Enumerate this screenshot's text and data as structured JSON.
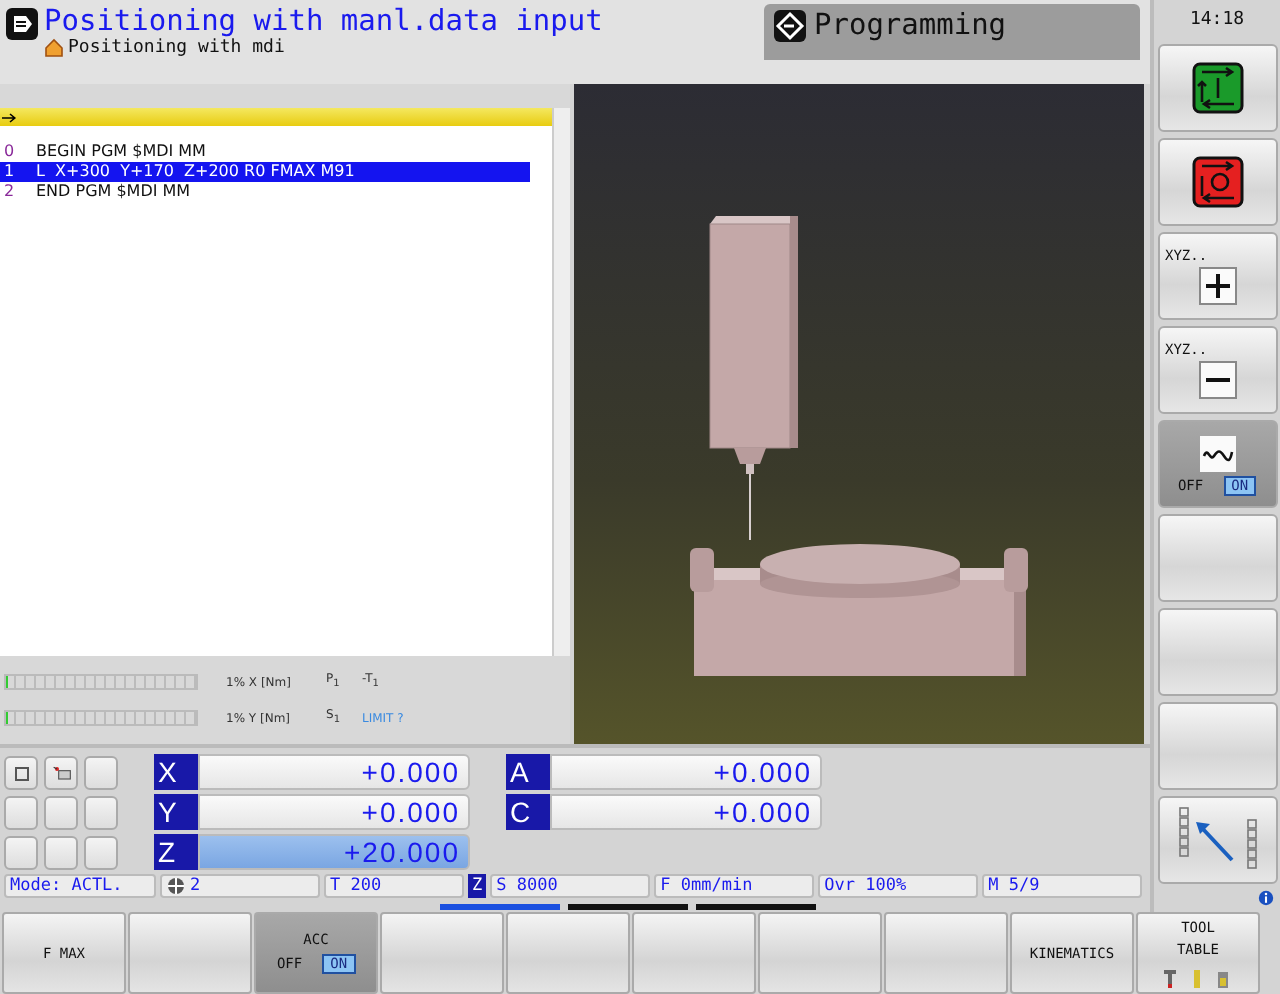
{
  "header": {
    "mode_title": "Positioning with manl.data input",
    "program_name": "Positioning with mdi",
    "secondary_mode": "Programming"
  },
  "clock": "14:18",
  "program": {
    "lines": [
      {
        "number": "0",
        "text": "BEGIN PGM $MDI MM",
        "selected": false
      },
      {
        "number": "1",
        "text": "L  X+300  Y+170  Z+200 R0 FMAX M91",
        "selected": true
      },
      {
        "number": "2",
        "text": "END PGM $MDI MM",
        "selected": false
      }
    ]
  },
  "load_meters": [
    {
      "level": 0.01,
      "reading": "1% X [Nm]",
      "param": "P$_{1}$",
      "value": "-T$_{1}$",
      "warning": false
    },
    {
      "level": 0.01,
      "reading": "1% Y [Nm]",
      "param": "S$_{1}$",
      "value": "LIMIT ?",
      "warning": true
    }
  ],
  "axes_left": [
    {
      "label": "X",
      "value": "+0.000",
      "selected": false
    },
    {
      "label": "Y",
      "value": "+0.000",
      "selected": false
    },
    {
      "label": "Z",
      "value": "+20.000",
      "selected": true
    }
  ],
  "axes_right": [
    {
      "label": "A",
      "value": "+0.000",
      "selected": false
    },
    {
      "label": "C",
      "value": "+0.000",
      "selected": false
    }
  ],
  "status_bar": {
    "mode": "Mode: ACTL.",
    "datum": "2",
    "tool": "T 200",
    "tool_axis": "Z",
    "spindle": "S 8000",
    "feed": "F 0mm/min",
    "override": "Ovr 100%",
    "m_functions": "M 5/9"
  },
  "side_softkeys": [
    {
      "kind": "start"
    },
    {
      "kind": "stop"
    },
    {
      "kind": "plus",
      "label": "XYZ.."
    },
    {
      "kind": "minus",
      "label": "XYZ.."
    },
    {
      "kind": "toggle",
      "off": "OFF",
      "on_label": "ON",
      "on": true
    },
    {
      "kind": "empty"
    },
    {
      "kind": "empty"
    },
    {
      "kind": "empty"
    },
    {
      "kind": "jog"
    }
  ],
  "softkey_pages": [
    {
      "selected": true
    },
    {
      "selected": false
    },
    {
      "selected": false
    }
  ],
  "softkeys": [
    {
      "kind": "text",
      "label": "F MAX"
    },
    {
      "kind": "empty"
    },
    {
      "kind": "toggle",
      "label": "ACC",
      "off": "OFF",
      "on_label": "ON",
      "on": true
    },
    {
      "kind": "empty"
    },
    {
      "kind": "empty"
    },
    {
      "kind": "empty"
    },
    {
      "kind": "empty"
    },
    {
      "kind": "empty"
    },
    {
      "kind": "text",
      "label": "KINEMATICS"
    },
    {
      "kind": "tools",
      "label": "TOOL TABLE"
    }
  ]
}
